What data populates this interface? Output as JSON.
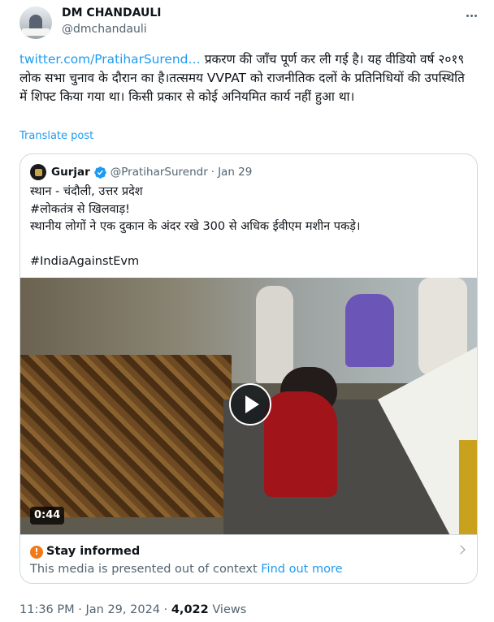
{
  "author": {
    "display_name": "DM CHANDAULI",
    "handle": "@dmchandauli"
  },
  "tweet": {
    "link_text": "twitter.com/PratiharSurend…",
    "text": " प्रकरण की जाँच पूर्ण कर ली गई है। यह वीडियो वर्ष २०१९ लोक सभा चुनाव के दौरान का है।तत्समय VVPAT को राजनीतिक दलों के प्रतिनिधियों  की उपस्थिति में शिफ्ट किया गया था। किसी प्रकार से कोई अनियमित कार्य नहीं हुआ था।",
    "translate_label": "Translate post"
  },
  "quote": {
    "display_name": "Gurjar",
    "handle": "@PratiharSurendr",
    "date": "Jan 29",
    "lines": [
      "स्थान - चंदौली, उत्तर प्रदेश",
      "#लोकतंत्र से खिलवाड़!",
      "स्थानीय लोगों ने एक दुकान के अंदर रखे 300 से अधिक ईवीएम मशीन पकड़े।",
      "",
      "#IndiaAgainstEvm"
    ],
    "video_duration": "0:44",
    "notice": {
      "title": "Stay informed",
      "description": "This media is presented out of context",
      "link": "Find out more"
    }
  },
  "meta": {
    "time": "11:36 PM",
    "separator": "·",
    "date": "Jan 29, 2024",
    "views_count": "4,022",
    "views_label": "Views"
  },
  "colors": {
    "link": "#1d9bf0",
    "verified": "#1d9bf0",
    "alert": "#f07a1a",
    "muted": "#536471"
  },
  "icons": [
    "more-icon",
    "verified-icon",
    "play-icon",
    "alert-icon",
    "chevron-right-icon"
  ]
}
